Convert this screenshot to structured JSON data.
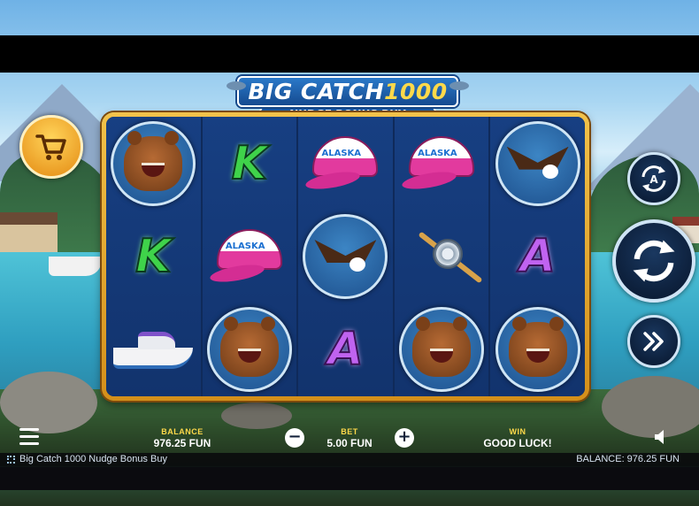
{
  "logo": {
    "line1_word": "BIG CATCH",
    "line1_num": "1000",
    "line2": "NUDGE BONUS BUY"
  },
  "reels": [
    [
      "bear",
      "K",
      "boat"
    ],
    [
      "K",
      "cap",
      "bear"
    ],
    [
      "cap",
      "eagle",
      "A"
    ],
    [
      "cap",
      "fishing-reel",
      "bear"
    ],
    [
      "eagle",
      "A",
      "bear"
    ]
  ],
  "cap_text": "ALASKA",
  "controls": {
    "buy_icon": "cart-icon",
    "autoplay_letter": "A",
    "spin_icon": "spin-arrows-icon",
    "turbo_icon": "fast-forward-icon"
  },
  "bar": {
    "balance_label": "BALANCE",
    "balance_value": "976.25 FUN",
    "bet_label": "BET",
    "bet_value": "5.00 FUN",
    "minus": "−",
    "plus": "+",
    "win_label": "WIN",
    "win_value": "GOOD LUCK!"
  },
  "footer": {
    "game_title": "Big Catch 1000 Nudge Bonus Buy",
    "balance_text": "BALANCE: 976.25 FUN"
  },
  "colors": {
    "frame": "#f2c24a",
    "reel_bg": "#173f82",
    "accent_yellow": "#ffd94a"
  }
}
